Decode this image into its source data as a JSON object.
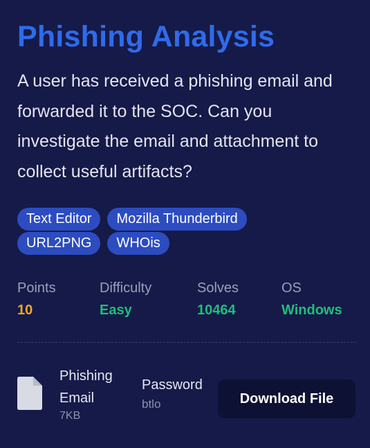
{
  "challenge": {
    "title": "Phishing Analysis",
    "description": "A user has received a phishing email and forwarded it to the SOC. Can you investigate the email and attachment to collect useful artifacts?",
    "tags": [
      "Text Editor",
      "Mozilla Thunderbird",
      "URL2PNG",
      "WHOis"
    ]
  },
  "stats": {
    "points": {
      "label": "Points",
      "value": "10",
      "color": "#f5a623"
    },
    "difficulty": {
      "label": "Difficulty",
      "value": "Easy",
      "color": "#1fbf7a"
    },
    "solves": {
      "label": "Solves",
      "value": "10464",
      "color": "#1fbf7a"
    },
    "os": {
      "label": "OS",
      "value": "Windows",
      "color": "#1fbf7a"
    }
  },
  "file": {
    "icon": "file-icon",
    "name": "Phishing Email",
    "size": "7KB",
    "password_label": "Password",
    "password_value": "btlo",
    "download_label": "Download File"
  }
}
